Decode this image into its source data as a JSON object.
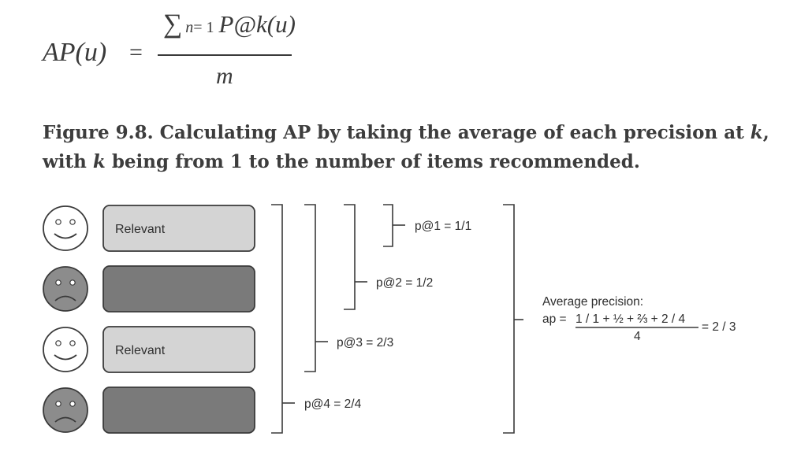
{
  "formula": {
    "lhs": "AP(u)",
    "equals": "=",
    "sigma": "∑",
    "limits_sup": "n",
    "limits_eq": "= 1",
    "numerator_term": "P@k(u)",
    "denominator": "m"
  },
  "caption": {
    "part1": "Figure 9.8. Calculating AP by taking the average of each precision at ",
    "k1": "k",
    "part2": ", with ",
    "k2": "k",
    "part3": " being from 1 to the number of items recommended."
  },
  "figure": {
    "items": [
      {
        "face": "smiley-face-icon",
        "label": "Relevant",
        "relevant": true
      },
      {
        "face": "frowny-face-icon",
        "label": "",
        "relevant": false
      },
      {
        "face": "smiley-face-icon",
        "label": "Relevant",
        "relevant": true
      },
      {
        "face": "frowny-face-icon",
        "label": "",
        "relevant": false
      }
    ],
    "precisions": [
      "p@1 = 1/1",
      "p@2 = 1/2",
      "p@3 = 2/3",
      "p@4 = 2/4"
    ],
    "average": {
      "title": "Average precision:",
      "ap_prefix": "ap =",
      "numerator": "1 / 1 + ½ + ⅔ + 2 / 4",
      "denominator": "4",
      "result": "= 2 / 3"
    },
    "colors": {
      "relevant_box": "#d4d4d4",
      "nonrelevant_box": "#7a7a7a",
      "frowny_face": "#8c8c8c",
      "line": "#3a3a3a"
    }
  }
}
